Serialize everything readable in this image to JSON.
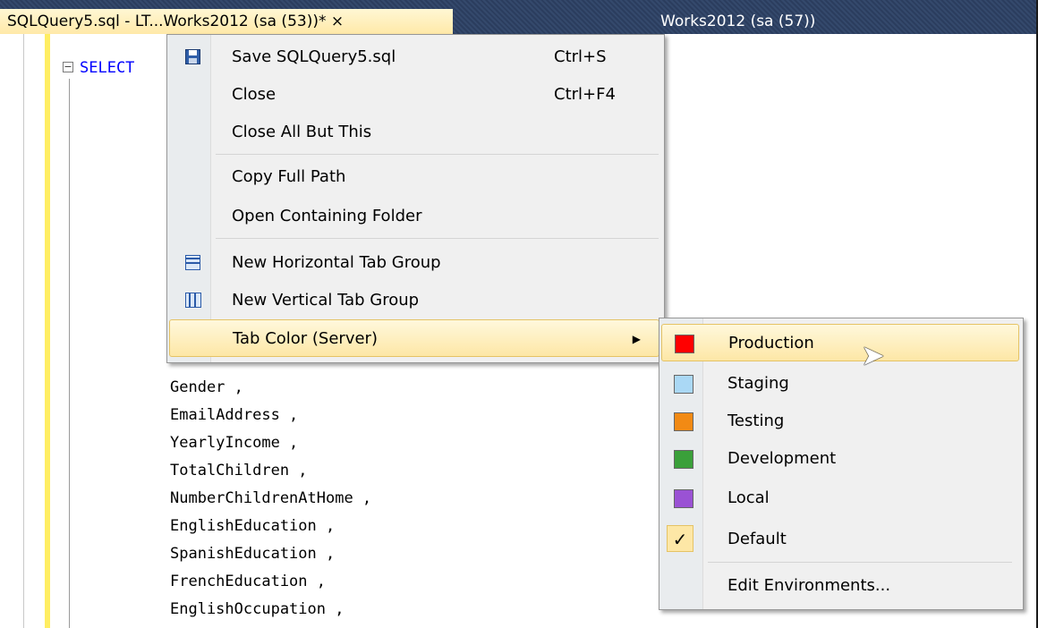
{
  "tabs": {
    "active_label": "SQLQuery5.sql - LT...Works2012 (sa (53))* ×",
    "inactive_label": "Works2012 (sa (57))"
  },
  "editor": {
    "keyword": "SELECT",
    "lines": [
      "Gender ,",
      "EmailAddress ,",
      "YearlyIncome ,",
      "TotalChildren ,",
      "NumberChildrenAtHome ,",
      "EnglishEducation ,",
      "SpanishEducation ,",
      "FrenchEducation ,",
      "EnglishOccupation ,"
    ]
  },
  "context_menu": {
    "save": {
      "label": "Save SQLQuery5.sql",
      "shortcut": "Ctrl+S",
      "icon": "save-icon"
    },
    "close": {
      "label": "Close",
      "shortcut": "Ctrl+F4"
    },
    "close_all_but_this": {
      "label": "Close All But This"
    },
    "copy_full_path": {
      "label": "Copy Full Path"
    },
    "open_containing_folder": {
      "label": "Open Containing Folder"
    },
    "new_horizontal_tab_group": {
      "label": "New Horizontal Tab Group",
      "icon": "horizontal-split-icon"
    },
    "new_vertical_tab_group": {
      "label": "New Vertical Tab Group",
      "icon": "vertical-split-icon"
    },
    "tab_color": {
      "label": "Tab Color (Server)",
      "arrow": "▶"
    }
  },
  "tab_color_submenu": {
    "items": [
      {
        "label": "Production",
        "color": "#ff0000"
      },
      {
        "label": "Staging",
        "color": "#aad8f5"
      },
      {
        "label": "Testing",
        "color": "#f28a14"
      },
      {
        "label": "Development",
        "color": "#3aa03a"
      },
      {
        "label": "Local",
        "color": "#9a52d4"
      },
      {
        "label": "Default",
        "checked": true
      }
    ],
    "edit_environments": "Edit Environments..."
  }
}
